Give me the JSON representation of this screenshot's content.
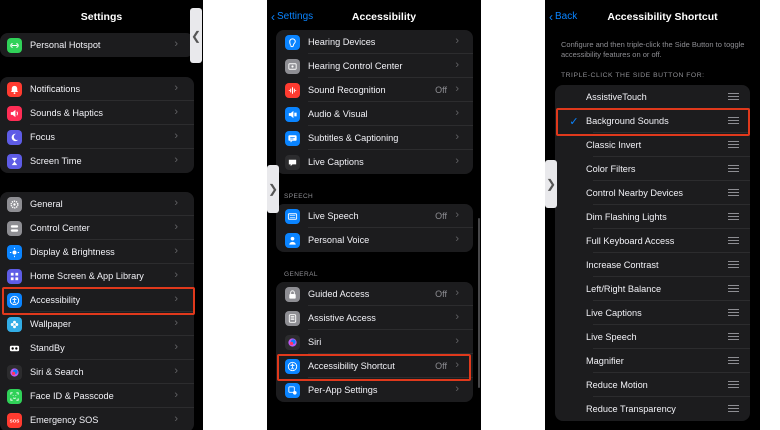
{
  "panel1": {
    "title": "Settings",
    "groups": [
      [
        {
          "label": "Personal Hotspot",
          "icon": "link-icon",
          "color": "#30d158"
        }
      ],
      [
        {
          "label": "Notifications",
          "icon": "bell-icon",
          "color": "#ff3b30"
        },
        {
          "label": "Sounds & Haptics",
          "icon": "speaker-icon",
          "color": "#ff2d55"
        },
        {
          "label": "Focus",
          "icon": "moon-icon",
          "color": "#5e5ce6"
        },
        {
          "label": "Screen Time",
          "icon": "hourglass-icon",
          "color": "#5e5ce6"
        }
      ],
      [
        {
          "label": "General",
          "icon": "gear-icon",
          "color": "#8e8e93"
        },
        {
          "label": "Control Center",
          "icon": "switches-icon",
          "color": "#8e8e93"
        },
        {
          "label": "Display & Brightness",
          "icon": "sun-icon",
          "color": "#0a84ff"
        },
        {
          "label": "Home Screen & App Library",
          "icon": "grid-icon",
          "color": "#5e5ce6"
        },
        {
          "label": "Accessibility",
          "icon": "accessibility-icon",
          "color": "#0a84ff"
        },
        {
          "label": "Wallpaper",
          "icon": "flower-icon",
          "color": "#32ade6"
        },
        {
          "label": "StandBy",
          "icon": "standby-icon",
          "color": "#1c1c1e"
        },
        {
          "label": "Siri & Search",
          "icon": "siri-icon",
          "color": "#2c2c2e"
        },
        {
          "label": "Face ID & Passcode",
          "icon": "faceid-icon",
          "color": "#30d158"
        },
        {
          "label": "Emergency SOS",
          "icon": "sos-icon",
          "color": "#ff3b30"
        }
      ]
    ]
  },
  "panel2": {
    "back": "Settings",
    "title": "Accessibility",
    "speech_header": "SPEECH",
    "general_header": "GENERAL",
    "groups": [
      [
        {
          "label": "Hearing Devices",
          "icon": "ear-icon",
          "color": "#0a84ff",
          "value": ""
        },
        {
          "label": "Hearing Control Center",
          "icon": "hearing-control-icon",
          "color": "#8e8e93",
          "value": ""
        },
        {
          "label": "Sound Recognition",
          "icon": "waveform-icon",
          "color": "#ff3b30",
          "value": "Off"
        },
        {
          "label": "Audio & Visual",
          "icon": "audio-visual-icon",
          "color": "#0a84ff",
          "value": ""
        },
        {
          "label": "Subtitles & Captioning",
          "icon": "caption-icon",
          "color": "#0a84ff",
          "value": ""
        },
        {
          "label": "Live Captions",
          "icon": "live-captions-icon",
          "color": "#2c2c2e",
          "value": ""
        }
      ],
      [
        {
          "label": "Live Speech",
          "icon": "keyboard-speech-icon",
          "color": "#0a84ff",
          "value": "Off"
        },
        {
          "label": "Personal Voice",
          "icon": "person-icon",
          "color": "#0a84ff",
          "value": ""
        }
      ],
      [
        {
          "label": "Guided Access",
          "icon": "lock-icon",
          "color": "#8e8e93",
          "value": "Off"
        },
        {
          "label": "Assistive Access",
          "icon": "assistive-icon",
          "color": "#8e8e93",
          "value": ""
        },
        {
          "label": "Siri",
          "icon": "siri-icon",
          "color": "#2c2c2e",
          "value": ""
        },
        {
          "label": "Accessibility Shortcut",
          "icon": "accessibility-icon",
          "color": "#0a84ff",
          "value": "Off"
        },
        {
          "label": "Per-App Settings",
          "icon": "app-settings-icon",
          "color": "#0a84ff",
          "value": ""
        }
      ]
    ]
  },
  "panel3": {
    "back": "Back",
    "title": "Accessibility Shortcut",
    "description": "Configure and then triple-click the Side Button to toggle accessibility features on or off.",
    "header": "TRIPLE-CLICK THE SIDE BUTTON FOR:",
    "items": [
      {
        "label": "AssistiveTouch",
        "checked": false
      },
      {
        "label": "Background Sounds",
        "checked": true
      },
      {
        "label": "Classic Invert",
        "checked": false
      },
      {
        "label": "Color Filters",
        "checked": false
      },
      {
        "label": "Control Nearby Devices",
        "checked": false
      },
      {
        "label": "Dim Flashing Lights",
        "checked": false
      },
      {
        "label": "Full Keyboard Access",
        "checked": false
      },
      {
        "label": "Increase Contrast",
        "checked": false
      },
      {
        "label": "Left/Right Balance",
        "checked": false
      },
      {
        "label": "Live Captions",
        "checked": false
      },
      {
        "label": "Live Speech",
        "checked": false
      },
      {
        "label": "Magnifier",
        "checked": false
      },
      {
        "label": "Reduce Motion",
        "checked": false
      },
      {
        "label": "Reduce Transparency",
        "checked": false
      }
    ]
  },
  "colors": {
    "highlight": "#e0391c",
    "accent": "#0a84ff"
  },
  "glyphs": {
    "chevron_right": "›",
    "chevron_left": "‹",
    "checkmark": "✓",
    "side_tab_left": "❮",
    "side_tab_right": "❯"
  }
}
